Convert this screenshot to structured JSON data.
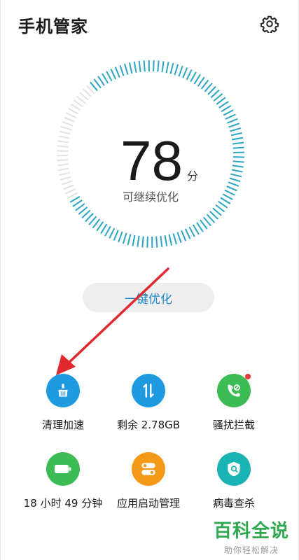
{
  "header": {
    "title": "手机管家",
    "settings_icon": "gear-icon"
  },
  "gauge": {
    "score": "78",
    "unit": "分",
    "subtitle": "可继续优化",
    "accent": "#2aa6c4"
  },
  "optimize": {
    "label": "一键优化",
    "color": "#1e88c8"
  },
  "tiles": [
    {
      "label": "清理加速",
      "icon": "broom-icon",
      "color": "#1e9be0"
    },
    {
      "label": "剩余 2.78GB",
      "icon": "data-transfer-icon",
      "color": "#1e9be0"
    },
    {
      "label": "骚扰拦截",
      "icon": "call-block-icon",
      "color": "#3dbb55",
      "badge": true
    },
    {
      "label": "18 小时 49 分钟",
      "icon": "battery-icon",
      "color": "#3dbb55"
    },
    {
      "label": "应用启动管理",
      "icon": "toggle-icon",
      "color": "#f59a18"
    },
    {
      "label": "病毒查杀",
      "icon": "shield-icon",
      "color": "#1ab3b3"
    }
  ],
  "annotation": {
    "arrow_color": "#e0282e"
  },
  "watermark": {
    "main": "百科全说",
    "sub": "助你轻松解决"
  }
}
